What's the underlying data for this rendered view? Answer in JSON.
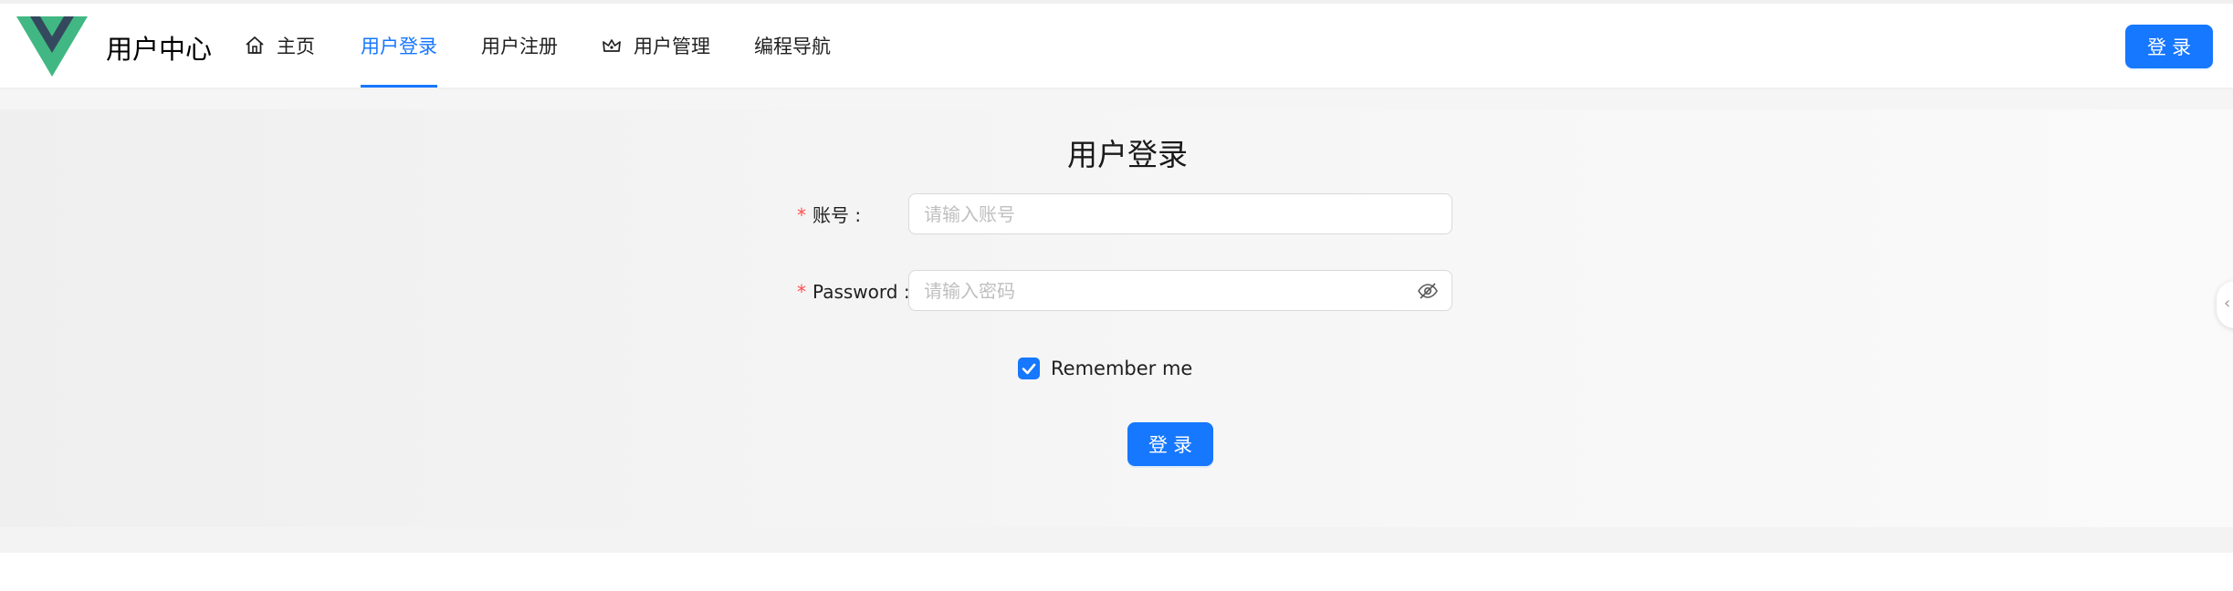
{
  "header": {
    "app_title": "用户中心",
    "login_button": "登录",
    "nav": [
      {
        "label": "主页",
        "icon": "home-icon",
        "active": false
      },
      {
        "label": "用户登录",
        "icon": null,
        "active": true
      },
      {
        "label": "用户注册",
        "icon": null,
        "active": false
      },
      {
        "label": "用户管理",
        "icon": "crown-icon",
        "active": false
      },
      {
        "label": "编程导航",
        "icon": null,
        "active": false
      }
    ]
  },
  "form": {
    "title": "用户登录",
    "account_label": "账号",
    "account_placeholder": "请输入账号",
    "password_label": "Password",
    "password_placeholder": "请输入密码",
    "required_mark": "*",
    "remember_label": "Remember me",
    "remember_checked": true,
    "submit_label": "登录"
  },
  "colors": {
    "accent": "#1677ff",
    "required": "#ff4d4f",
    "logo_outer": "#41b883",
    "logo_inner": "#35495e"
  }
}
